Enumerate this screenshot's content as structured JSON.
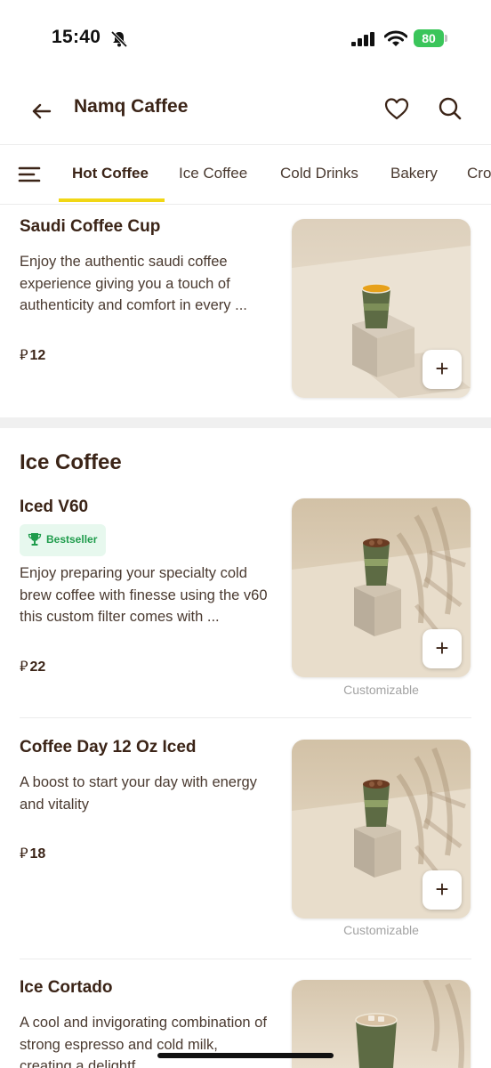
{
  "status_bar": {
    "time": "15:40",
    "battery": "80"
  },
  "header": {
    "title": "Namq Caffee"
  },
  "tabs": [
    {
      "label": "Hot Coffee",
      "active": true
    },
    {
      "label": "Ice Coffee",
      "active": false
    },
    {
      "label": "Cold Drinks",
      "active": false
    },
    {
      "label": "Bakery",
      "active": false
    },
    {
      "label": "Cro",
      "active": false
    }
  ],
  "currency_symbol": "⃁",
  "items": [
    {
      "title": "Saudi Coffee Cup",
      "description": "Enjoy the authentic saudi coffee experience giving you a touch of authenticity and comfort in every ...",
      "price": "12",
      "customizable": ""
    },
    {
      "title": "Iced V60",
      "badge": "Bestseller",
      "description": "Enjoy preparing your specialty cold brew coffee with finesse using the v60 this custom filter comes with ...",
      "price": "22",
      "customizable": "Customizable"
    },
    {
      "title": "Coffee Day 12 Oz Iced",
      "description": "A boost to start your day with energy and vitality",
      "price": "18",
      "customizable": "Customizable"
    },
    {
      "title": "Ice Cortado",
      "description": "A cool and invigorating combination of strong espresso and cold milk, creating a delightf",
      "price": "",
      "customizable": ""
    }
  ],
  "sections": {
    "ice_coffee": "Ice Coffee"
  },
  "add_label": "+",
  "colors": {
    "brand_text": "#3b2417",
    "tab_indicator": "#f1d715",
    "badge_bg": "#e7f8ee",
    "badge_text": "#1f9c4c"
  },
  "icons": [
    "bell-slash-icon",
    "signal-icon",
    "wifi-icon",
    "battery-icon",
    "back-arrow-icon",
    "heart-icon",
    "search-icon",
    "menu-icon",
    "trophy-icon",
    "plus-icon"
  ]
}
